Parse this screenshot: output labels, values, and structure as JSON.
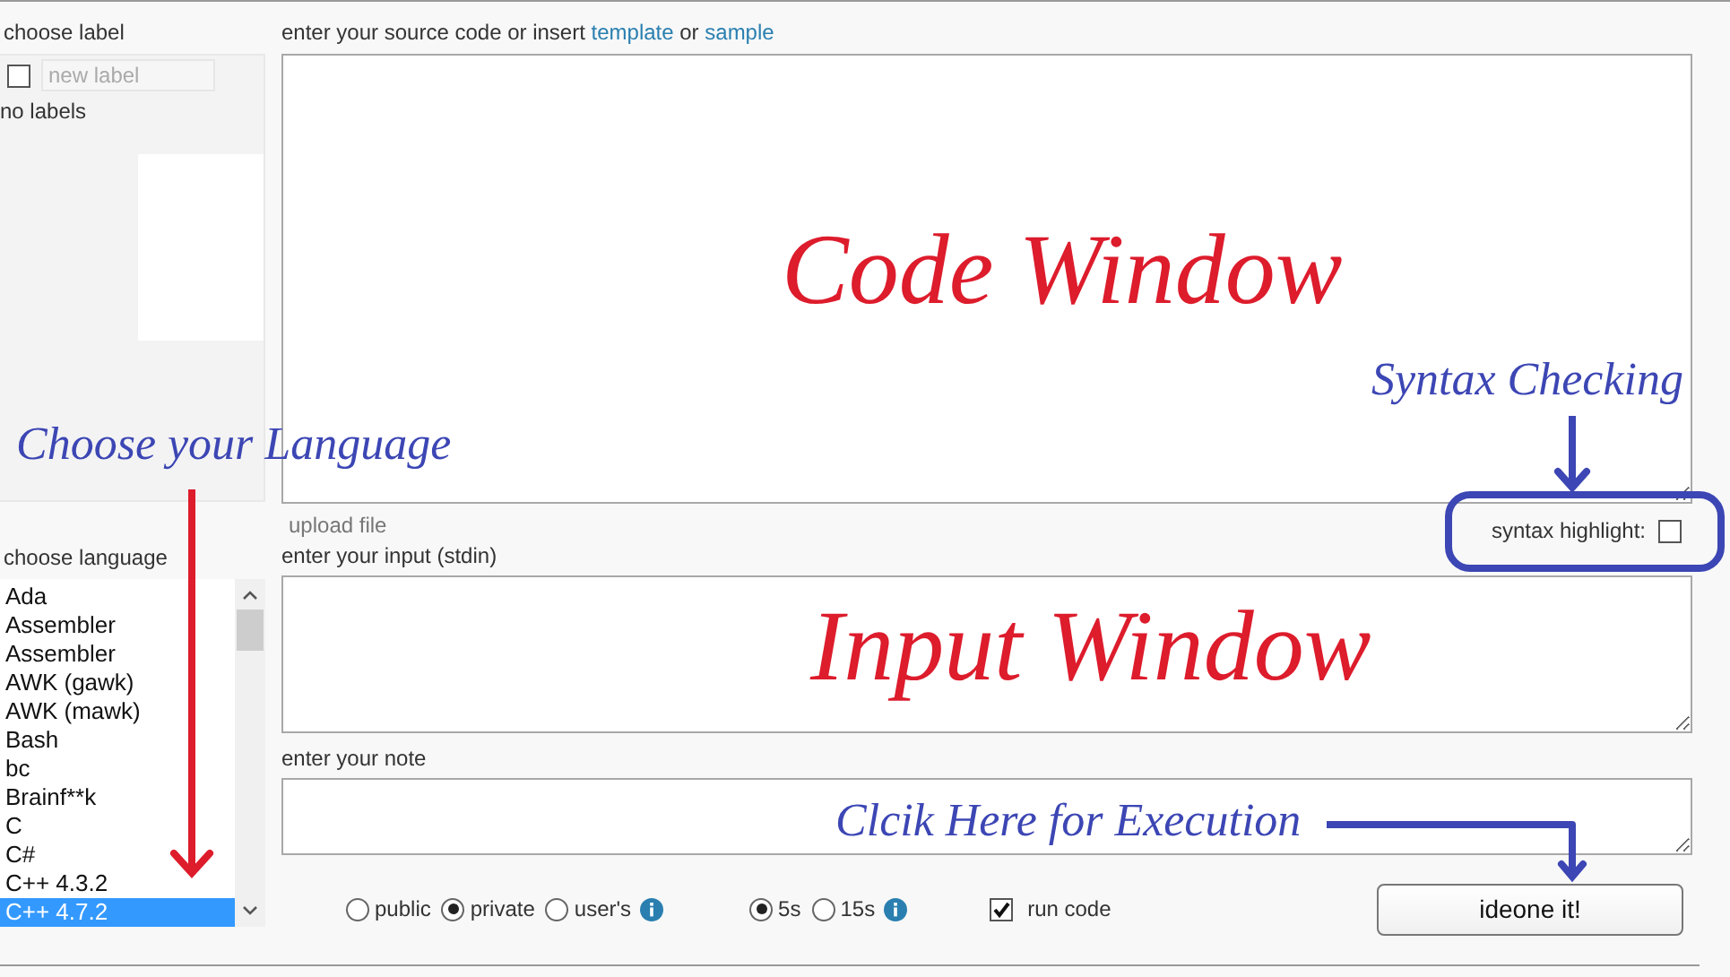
{
  "label_panel": {
    "heading": "choose label",
    "checkbox_checked": false,
    "new_label_placeholder": "new label",
    "empty_text": "no labels"
  },
  "source": {
    "prompt": "enter your source code or insert",
    "template_link": "template",
    "joiner": "or",
    "sample_link": "sample",
    "upload_link": "upload file",
    "syntax_label": "syntax highlight:",
    "syntax_checked": false
  },
  "language_panel": {
    "heading": "choose language",
    "languages": [
      {
        "label": "Ada",
        "selected": false
      },
      {
        "label": "Assembler",
        "selected": false
      },
      {
        "label": "Assembler",
        "selected": false
      },
      {
        "label": "AWK (gawk)",
        "selected": false
      },
      {
        "label": "AWK (mawk)",
        "selected": false
      },
      {
        "label": "Bash",
        "selected": false
      },
      {
        "label": "bc",
        "selected": false
      },
      {
        "label": "Brainf**k",
        "selected": false
      },
      {
        "label": "C",
        "selected": false
      },
      {
        "label": "C#",
        "selected": false
      },
      {
        "label": "C++ 4.3.2",
        "selected": false
      },
      {
        "label": "C++ 4.7.2",
        "selected": true
      }
    ]
  },
  "input": {
    "heading": "enter your input (stdin)"
  },
  "note": {
    "heading": "enter your note"
  },
  "visibility": [
    {
      "label": "public",
      "selected": false,
      "info": false
    },
    {
      "label": "private",
      "selected": true,
      "info": false
    },
    {
      "label": "user's",
      "selected": false,
      "info": true
    }
  ],
  "time_limit": [
    {
      "label": "5s",
      "selected": true,
      "info": false
    },
    {
      "label": "15s",
      "selected": false,
      "info": true
    }
  ],
  "run_code": {
    "label": "run code",
    "checked": true
  },
  "submit_button": "ideone it!",
  "annotations": [
    {
      "kind": "title",
      "text": "Code Window",
      "color": "#dd1c2c"
    },
    {
      "kind": "title",
      "text": "Input Window",
      "color": "#dd1c2c"
    },
    {
      "kind": "callout",
      "text": "Syntax Checking",
      "color": "#3c46b4"
    },
    {
      "kind": "callout",
      "text": "Choose your Language",
      "color": "#3c46b4"
    },
    {
      "kind": "callout",
      "text": "Clcik Here for Execution",
      "color": "#3c46b4"
    }
  ]
}
